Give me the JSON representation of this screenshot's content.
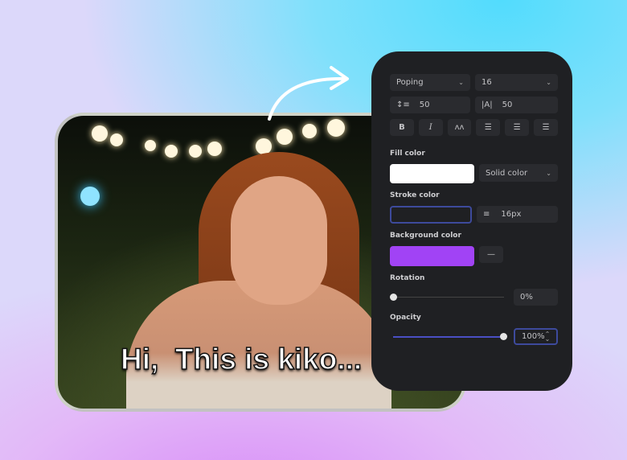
{
  "caption": "Hi,  This is kiko...",
  "panel": {
    "font": "Poping",
    "size": "16",
    "line_height": "50",
    "letter_spacing": "50",
    "format_buttons": [
      "B",
      "I",
      "ʌʌ",
      "left",
      "center",
      "right"
    ],
    "fill_label": "Fill color",
    "fill_color": "#ffffff",
    "fill_type": "Solid color",
    "stroke_label": "Stroke color",
    "stroke_width": "16px",
    "bg_label": "Background color",
    "bg_color": "#a143f5",
    "rotation_label": "Rotation",
    "rotation_value": "0%",
    "rotation": 0,
    "opacity_label": "Opacity",
    "opacity_value": "100%",
    "opacity": 1.0
  }
}
